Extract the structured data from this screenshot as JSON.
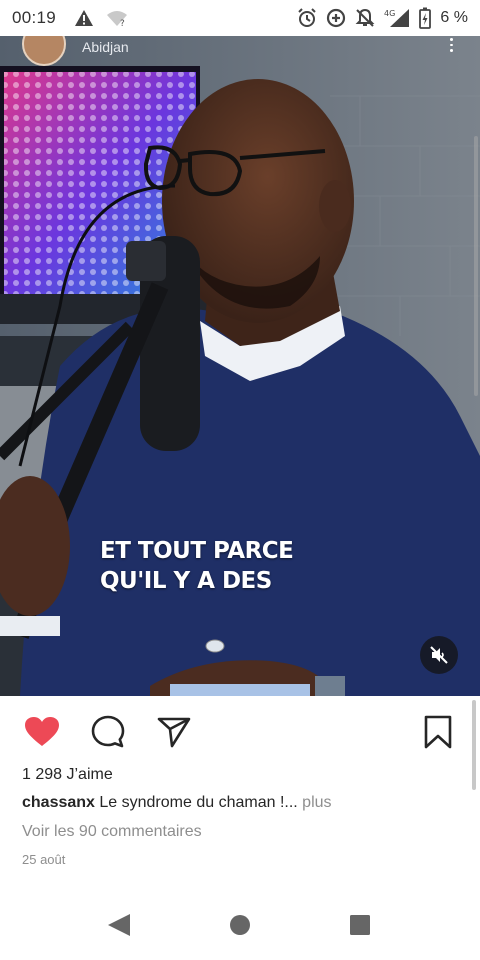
{
  "status_bar": {
    "time": "00:19",
    "network": "4G",
    "battery_text": "6 %",
    "icons": [
      "warning-icon",
      "wifi-question-icon",
      "alarm-icon",
      "data-saver-icon",
      "notifications-off-icon",
      "signal-icon",
      "battery-charging-icon"
    ]
  },
  "post": {
    "location": "Abidjan",
    "video_caption_line1": "ET TOUT PARCE",
    "video_caption_line2": "QU'IL Y A DES",
    "liked": true,
    "likes_text": "1 298 J’aime",
    "username": "chassanx",
    "caption_text": "Le syndrome du chaman !...",
    "more_label": "plus",
    "comments_link": "Voir les 90 commentaires",
    "date": "25 août"
  },
  "colors": {
    "like_red": "#ed4956",
    "text_dark": "#262626",
    "text_muted": "#8e8e8e",
    "sweater_navy": "#1f2f66"
  },
  "navbar": {
    "icons": [
      "back-icon",
      "home-icon",
      "recents-icon"
    ]
  }
}
